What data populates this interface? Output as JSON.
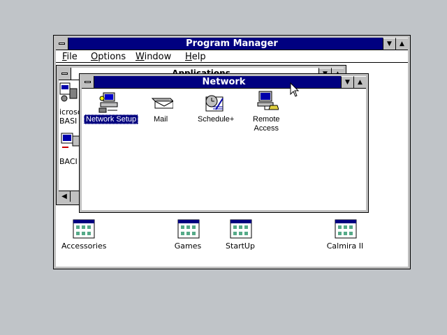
{
  "program_manager": {
    "title": "Program Manager",
    "menu": [
      {
        "label": "File",
        "underline": "F",
        "rest": "ile"
      },
      {
        "label": "Options",
        "underline": "O",
        "rest": "ptions"
      },
      {
        "label": "Window",
        "underline": "W",
        "rest": "indow"
      },
      {
        "label": "Help",
        "underline": "H",
        "rest": "elp"
      }
    ]
  },
  "applications_window": {
    "title": "Applications",
    "partial_labels": [
      "icroso",
      "BASI",
      "BACI"
    ]
  },
  "network_window": {
    "title": "Network",
    "icons": [
      {
        "label": "Network Setup",
        "icon": "network-setup-icon",
        "selected": true
      },
      {
        "label": "Mail",
        "icon": "mail-icon"
      },
      {
        "label": "Schedule+",
        "icon": "schedule-icon"
      },
      {
        "label": "Remote Access",
        "line1": "Remote",
        "line2": "Access",
        "icon": "remote-access-icon"
      }
    ]
  },
  "group_icons": [
    {
      "label": "Accessories",
      "icon": "program-group-icon"
    },
    {
      "label": "Games",
      "icon": "program-group-icon"
    },
    {
      "label": "StartUp",
      "icon": "program-group-icon"
    },
    {
      "label": "Calmira II",
      "icon": "program-group-icon"
    }
  ],
  "colors": {
    "titlebar_active": "#000080",
    "desktop": "#c0c4c8",
    "window_frame": "#c0c0c0"
  }
}
